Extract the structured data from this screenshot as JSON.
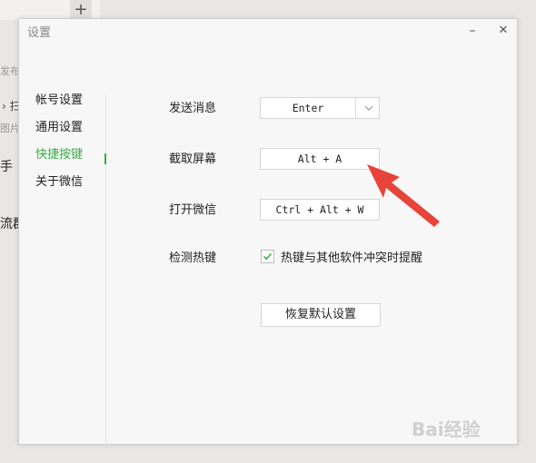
{
  "background": {
    "new_tab_symbol": "+",
    "fragments": [
      "发布",
      "扫",
      "图片",
      "手",
      "流群"
    ]
  },
  "dialog": {
    "title": "设置",
    "minimize_symbol": "–",
    "close_symbol": "✕"
  },
  "sidebar": {
    "items": [
      {
        "label": "帐号设置",
        "active": false
      },
      {
        "label": "通用设置",
        "active": false
      },
      {
        "label": "快捷按键",
        "active": true
      },
      {
        "label": "关于微信",
        "active": false
      }
    ]
  },
  "shortcuts": {
    "send": {
      "label": "发送消息",
      "value": "Enter"
    },
    "screenshot": {
      "label": "截取屏幕",
      "value": "Alt + A"
    },
    "open": {
      "label": "打开微信",
      "value": "Ctrl + Alt + W"
    },
    "detect": {
      "label": "检测热键",
      "checkbox_label": "热键与其他软件冲突时提醒",
      "checked": true
    }
  },
  "reset_button": "恢复默认设置",
  "colors": {
    "accent": "#35b044",
    "annotation_arrow": "#e8443a"
  },
  "watermark": "Bai经验"
}
